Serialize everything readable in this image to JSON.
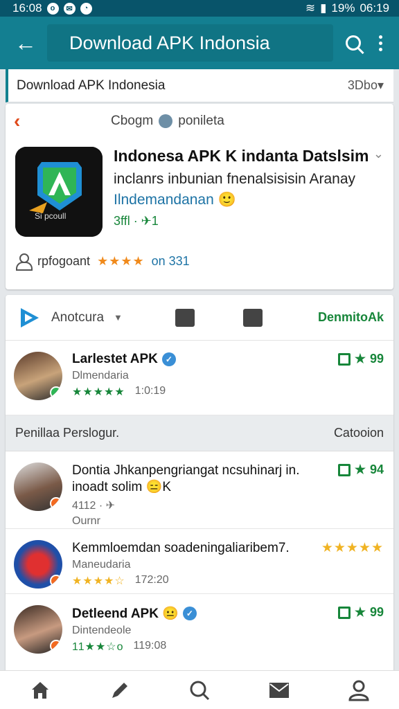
{
  "statusbar": {
    "time_left": "16:08",
    "battery": "19%",
    "time_right": "06:19"
  },
  "appbar": {
    "title": "Download APK Indonsia"
  },
  "subheader": {
    "title": "Download APK Indonesia",
    "right": "3Dbo▾"
  },
  "appcard": {
    "category": "Cbogm",
    "category2": "ponileta",
    "name": "Indonesa APK K indanta Datslsim",
    "desc": "inclanrs inbunian fnenalsisisin Aranay",
    "link": "Ilndemandanan 🙂",
    "meta": "3ffl · ✈1",
    "bottom_label": "rpfogoant",
    "bottom_stars": "★★★★",
    "rating_label": "on 331",
    "icon_text": "Si pcoull"
  },
  "actions": {
    "sort_label": "Anotcura",
    "download_label": "DenmitoAk"
  },
  "reviews_top": [
    {
      "name": "Larlestet APK",
      "sub": "Dlmendaria",
      "stars": "★★★★★",
      "time": "1:0:19",
      "score": "99"
    }
  ],
  "section": {
    "left": "Penillaa Perslogur.",
    "right": "Catooion"
  },
  "reviews": [
    {
      "name": "Dontia Jhkanpengriangat ncsuhinarj in.",
      "name2": "inoadt solim 😑K",
      "meta": "4112 · ✈",
      "meta2": "Ournr",
      "score": "94"
    },
    {
      "name": "Kemmloemdan soadeningaliaribem7.",
      "sub": "Maneudaria",
      "stars": "★★★★☆",
      "time": "172:20",
      "stars_right": "★★★★★"
    },
    {
      "name": "Detleend APK 😐",
      "sub": "Dintendeole",
      "stars": "11★★☆o",
      "time": "119:08",
      "score": "99"
    }
  ],
  "colors": {
    "appbar": "#137f91",
    "accent_green": "#17863a",
    "accent_orange": "#f08a1c",
    "link_blue": "#1d73a5"
  }
}
